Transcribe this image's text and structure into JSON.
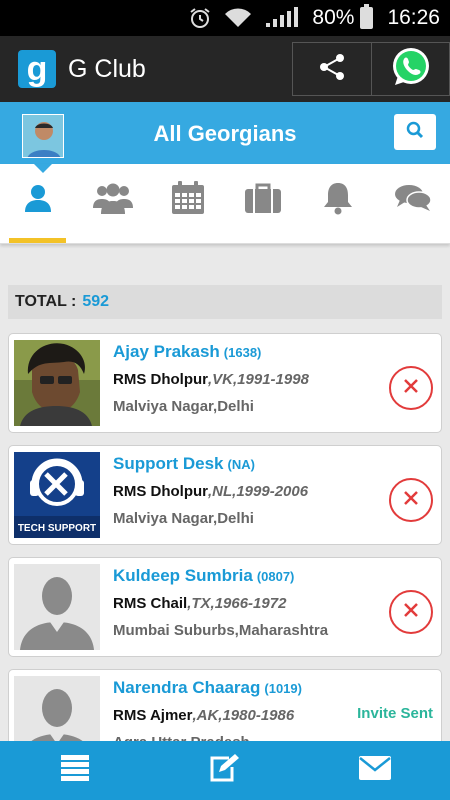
{
  "status_bar": {
    "battery": "80%",
    "time": "16:26"
  },
  "app_bar": {
    "logo_letter": "g",
    "title": "G Club"
  },
  "header": {
    "title": "All Georgians"
  },
  "tabs": [
    {
      "name": "profile",
      "icon": "user-icon",
      "active": true
    },
    {
      "name": "groups",
      "icon": "group-icon",
      "active": false
    },
    {
      "name": "calendar",
      "icon": "calendar-icon",
      "active": false
    },
    {
      "name": "jobs",
      "icon": "briefcase-icon",
      "active": false
    },
    {
      "name": "notifications",
      "icon": "bell-icon",
      "active": false
    },
    {
      "name": "chat",
      "icon": "chat-icon",
      "active": false
    }
  ],
  "total": {
    "label": "TOTAL :",
    "value": "592"
  },
  "members": [
    {
      "name": "Ajay Prakash",
      "id": "(1638)",
      "school": "RMS Dholpur",
      "meta": ",VK,1991-1998",
      "location": "Malviya Nagar,Delhi",
      "action": "remove",
      "photo": "person-photo"
    },
    {
      "name": "Support Desk",
      "id": "(NA)",
      "school": "RMS Dholpur",
      "meta": ",NL,1999-2006",
      "location": "Malviya Nagar,Delhi",
      "action": "remove",
      "photo": "tech-support",
      "photo_text": "TECH SUPPORT"
    },
    {
      "name": "Kuldeep Sumbria",
      "id": "(0807)",
      "school": "RMS Chail",
      "meta": ",TX,1966-1972",
      "location": "Mumbai Suburbs,Maharashtra",
      "action": "remove",
      "photo": "silhouette"
    },
    {
      "name": "Narendra Chaarag",
      "id": "(1019)",
      "school": "RMS Ajmer",
      "meta": ",AK,1980-1986",
      "location": "Agra,Uttar Pradesh",
      "action": "invite",
      "action_label": "Invite Sent",
      "photo": "silhouette"
    }
  ],
  "bottom_bar": [
    {
      "icon": "list-icon"
    },
    {
      "icon": "edit-icon"
    },
    {
      "icon": "mail-icon"
    }
  ],
  "colors": {
    "accent": "#1a9ad6",
    "header": "#36a9e1",
    "tab_indicator": "#f3c227",
    "remove": "#e23b3b",
    "invite": "#2bb59b"
  }
}
